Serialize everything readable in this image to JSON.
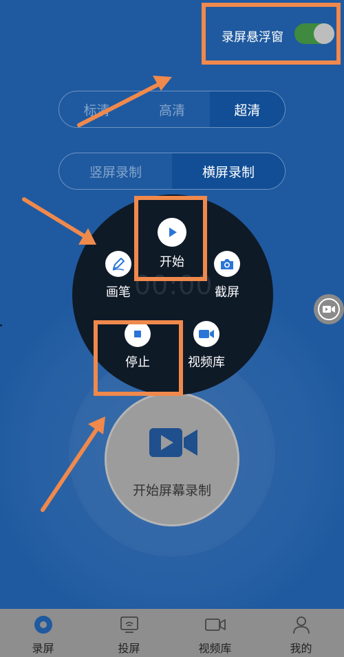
{
  "header": {
    "float_window_label": "录屏悬浮窗",
    "float_window_enabled": true
  },
  "quality_options": [
    "标清",
    "高清",
    "超清"
  ],
  "quality_selected": "超清",
  "orientation_options": [
    "竖屏录制",
    "横屏录制"
  ],
  "orientation_selected": "横屏录制",
  "float_menu": {
    "pen_label": "画笔",
    "start_label": "开始",
    "screenshot_label": "截屏",
    "stop_label": "停止",
    "video_library_label": "视频库",
    "background_timer": "00:00"
  },
  "record_button_label": "开始屏幕录制",
  "tabbar": {
    "tabs": [
      {
        "label": "录屏",
        "icon": "record-icon"
      },
      {
        "label": "投屏",
        "icon": "cast-icon"
      },
      {
        "label": "视频库",
        "icon": "video-camera-icon"
      },
      {
        "label": "我的",
        "icon": "person-icon"
      }
    ]
  },
  "colors": {
    "background": "#1f5aa0",
    "accent": "#2a75d6",
    "highlight": "#f0894c",
    "menu_bg": "#0f1a27",
    "toggle_on": "#3f8a3f"
  }
}
